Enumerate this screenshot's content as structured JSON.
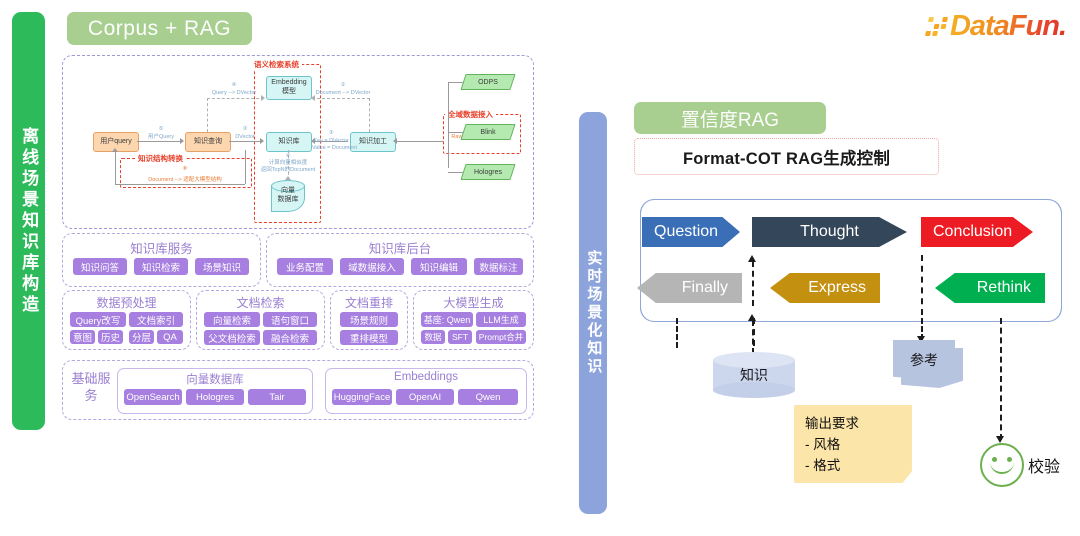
{
  "left_section": {
    "banner_label": "离线场景知识库构造",
    "banner_color": "#2cba5a",
    "pill_label": "Corpus + RAG",
    "pill_color": "#a8cf8f",
    "architecture": {
      "semantic_box_label": "语义检索系统",
      "knowledge_convert_label": "知识结构转换",
      "global_data_label": "全域数据接入",
      "nodes": {
        "user_query": "用户query",
        "knowledge_query": "知识查询",
        "embedding_model": "Embedding\n模型",
        "knowledge_base": "知识库",
        "vector_db": "向量\n数据库",
        "knowledge_process": "知识加工"
      },
      "sources": [
        "ODPS",
        "Blink",
        "Hologres"
      ],
      "edges": [
        {
          "num": "①",
          "text": "Raw Data --> Document"
        },
        {
          "num": "②",
          "text": "Document --> DVector"
        },
        {
          "num": "③",
          "text": "Key = DVector\nValue = Document"
        },
        {
          "num": "④",
          "text": "Query --> DVector"
        },
        {
          "num": "⑤",
          "text": "用户Query"
        },
        {
          "num": "⑥",
          "text": "DVector"
        },
        {
          "num": "⑦",
          "text": "计算向量相似度\n返回TopN的Document"
        },
        {
          "num": "⑧",
          "text": "Document --> 适配大模型结构"
        }
      ]
    },
    "service_panels": [
      {
        "title": "知识库服务",
        "rows": [
          [
            "知识问答",
            "知识检索",
            "场景知识"
          ]
        ]
      },
      {
        "title": "知识库后台",
        "rows": [
          [
            "业务配置",
            "域数据接入",
            "知识编辑",
            "数据标注"
          ]
        ]
      }
    ],
    "capability_panels": [
      {
        "title": "数据预处理",
        "rows": [
          [
            "Query改写",
            "文档索引"
          ],
          [
            "意图",
            "历史",
            "分层",
            "QA"
          ]
        ]
      },
      {
        "title": "文档检索",
        "rows": [
          [
            "向量检索",
            "语句窗口"
          ],
          [
            "父文档检索",
            "融合检索"
          ]
        ]
      },
      {
        "title": "文档重排",
        "rows": [
          [
            "场景规则"
          ],
          [
            "重排模型"
          ]
        ]
      },
      {
        "title": "大模型生成",
        "rows": [
          [
            "基座: Qwen",
            "LLM生成"
          ],
          [
            "数据",
            "SFT",
            "Prompt合并"
          ]
        ]
      }
    ],
    "base_services": {
      "label": "基础服务",
      "groups": [
        {
          "title": "向量数据库",
          "items": [
            "OpenSearch",
            "Hologres",
            "Tair"
          ]
        },
        {
          "title": "Embeddings",
          "items": [
            "HuggingFace",
            "OpenAI",
            "Qwen"
          ]
        }
      ]
    }
  },
  "right_section": {
    "banner_label": "实时场景化知识",
    "banner_color": "#8ca4db",
    "pill_label": "置信度RAG",
    "cot_title": "Format-COT RAG生成控制",
    "flow_top": [
      {
        "label": "Question",
        "color": "#3a6fb8",
        "direction": "right"
      },
      {
        "label": "Thought",
        "color": "#34465a",
        "direction": "right"
      },
      {
        "label": "Conclusion",
        "color": "#ed1c24",
        "direction": "right"
      }
    ],
    "flow_bottom": [
      {
        "label": "Finally",
        "color": "#b5b5b5",
        "direction": "left"
      },
      {
        "label": "Express",
        "color": "#c49010",
        "direction": "left"
      },
      {
        "label": "Rethink",
        "color": "#00b050",
        "direction": "left"
      }
    ],
    "artifacts": {
      "knowledge_db": "知识",
      "reference_doc": "参考",
      "output_note": {
        "title": "输出要求",
        "items": [
          "- 风格",
          "- 格式",
          "..."
        ]
      },
      "validation_label": "校验"
    }
  },
  "brand": {
    "logo_text": "DataFun.",
    "logo_colors": [
      "#f4b223",
      "#f08a20",
      "#e8452e"
    ]
  }
}
